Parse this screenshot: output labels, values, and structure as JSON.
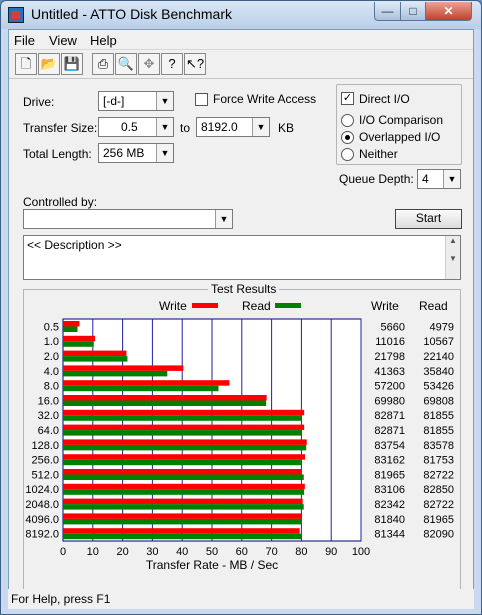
{
  "window": {
    "title": "Untitled - ATTO Disk Benchmark",
    "caption_min": "—",
    "caption_max": "□",
    "caption_close": "✕"
  },
  "menu": [
    "File",
    "View",
    "Help"
  ],
  "toolbar": {
    "icons": [
      "new-doc-icon",
      "open-folder-icon",
      "save-icon",
      "print-icon",
      "print-preview-icon",
      "move-icon",
      "help-icon",
      "context-help-icon"
    ]
  },
  "form": {
    "drive_label": "Drive:",
    "drive_value": "[-d-]",
    "force_write_label": "Force Write Access",
    "force_write_checked": false,
    "direct_io_label": "Direct I/O",
    "direct_io_checked": true,
    "transfer_size_label": "Transfer Size:",
    "transfer_from": "0.5",
    "to_label": "to",
    "transfer_to": "8192.0",
    "kb_label": "KB",
    "total_length_label": "Total Length:",
    "total_length_value": "256 MB",
    "io_options": [
      "I/O Comparison",
      "Overlapped I/O",
      "Neither"
    ],
    "io_selected": "Overlapped I/O",
    "queue_depth_label": "Queue Depth:",
    "queue_depth_value": "4",
    "controlled_by_label": "Controlled by:",
    "controlled_by_value": "",
    "start_label": "Start",
    "description_text": "<< Description >>"
  },
  "results": {
    "title": "Test Results",
    "write_legend": "Write",
    "read_legend": "Read",
    "write_col": "Write",
    "read_col": "Read",
    "write_color": "#ff0000",
    "read_color": "#008000",
    "x_axis_label": "Transfer Rate - MB / Sec"
  },
  "chart_data": {
    "type": "bar",
    "orientation": "horizontal",
    "categories": [
      "0.5",
      "1.0",
      "2.0",
      "4.0",
      "8.0",
      "16.0",
      "32.0",
      "64.0",
      "128.0",
      "256.0",
      "512.0",
      "1024.0",
      "2048.0",
      "4096.0",
      "8192.0"
    ],
    "series": [
      {
        "name": "Write",
        "values": [
          5660,
          11016,
          21798,
          41363,
          57200,
          69980,
          82871,
          82871,
          83754,
          83162,
          81965,
          83106,
          82342,
          81840,
          81344
        ]
      },
      {
        "name": "Read",
        "values": [
          4979,
          10567,
          22140,
          35840,
          53426,
          69808,
          81855,
          81855,
          83578,
          81753,
          82722,
          82850,
          82722,
          81965,
          82090
        ]
      }
    ],
    "x_ticks": [
      "0",
      "10",
      "20",
      "30",
      "40",
      "50",
      "60",
      "70",
      "80",
      "90",
      "100"
    ],
    "xlabel": "Transfer Rate - MB / Sec",
    "xlim": [
      0,
      100
    ],
    "grid": true,
    "legend": "top"
  },
  "status": {
    "text": "For Help, press F1"
  }
}
